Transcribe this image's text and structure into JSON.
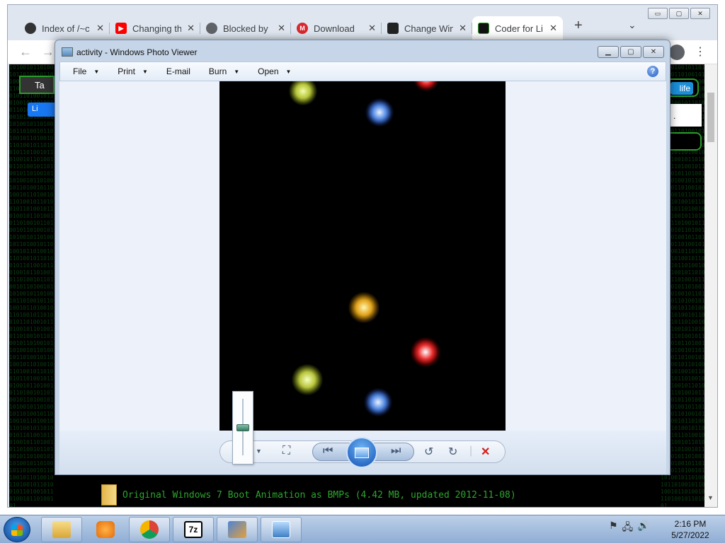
{
  "browser": {
    "tabs": [
      {
        "title": "Index of /~c",
        "favicon": "globe-icon",
        "active": false
      },
      {
        "title": "Changing th",
        "favicon": "youtube-icon",
        "active": false
      },
      {
        "title": "Blocked by",
        "favicon": "globe-icon",
        "active": false
      },
      {
        "title": "Download",
        "favicon": "mega-icon",
        "active": false
      },
      {
        "title": "Change Win",
        "favicon": "site-icon",
        "active": false
      },
      {
        "title": "Coder for Li",
        "favicon": "site-icon",
        "active": true
      }
    ],
    "new_tab": "+",
    "window_controls": [
      "▭",
      "▢",
      "✕"
    ]
  },
  "page": {
    "left_button": "Ta",
    "like_button": "Li",
    "right_button": "life",
    "right_white_text": ".",
    "download_line": "Original Windows 7 Boot Animation as BMPs (4.42 MB, updated 2012-11-08)"
  },
  "viewer": {
    "title": "activity - Windows Photo Viewer",
    "menu": [
      {
        "label": "File",
        "dropdown": true
      },
      {
        "label": "Print",
        "dropdown": true
      },
      {
        "label": "E-mail",
        "dropdown": false
      },
      {
        "label": "Burn",
        "dropdown": true
      },
      {
        "label": "Open",
        "dropdown": true
      }
    ],
    "help": "?"
  },
  "taskbar": {
    "time": "2:16 PM",
    "date": "5/27/2022"
  },
  "colors": {
    "matrix_green": "#0d4a15",
    "link_green": "#2ea42e",
    "photo_bg": "#000000"
  }
}
